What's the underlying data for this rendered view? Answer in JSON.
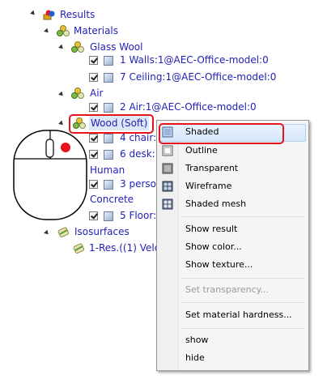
{
  "tree": {
    "results": "Results",
    "materials": "Materials",
    "glass_wool": "Glass Wool",
    "walls": "1 Walls:1@AEC-Office-model:0",
    "ceiling": "7 Ceiling:1@AEC-Office-model:0",
    "air": "Air",
    "air_item": "2 Air:1@AEC-Office-model:0",
    "wood": "Wood (Soft)",
    "chair": "4 chair:",
    "desk": "6 desk:",
    "human": "Human",
    "person": "3 perso",
    "concrete": "Concrete",
    "floor": "5 Floor:",
    "isosurfaces": "Isosurfaces",
    "res": "1-Res.((1) Velo"
  },
  "menu": {
    "items": [
      {
        "label": "Shaded"
      },
      {
        "label": "Outline"
      },
      {
        "label": "Transparent"
      },
      {
        "label": "Wireframe"
      },
      {
        "label": "Shaded mesh"
      },
      {
        "label": "Show result"
      },
      {
        "label": "Show color..."
      },
      {
        "label": "Show texture..."
      },
      {
        "label": "Set transparency..."
      },
      {
        "label": "Set material hardness..."
      },
      {
        "label": "show"
      },
      {
        "label": "hide"
      }
    ]
  },
  "colors": {
    "link_text": "#1f1fb5",
    "highlight_outline": "#e8141b",
    "mouse_button_dot": "#e8141b"
  },
  "icons": {
    "results": "results-folder-icon",
    "material": "material-spheres-icon",
    "object": "cube-icon",
    "isosurface": "isosurface-icon",
    "mouse": "mouse-right-click-icon"
  }
}
